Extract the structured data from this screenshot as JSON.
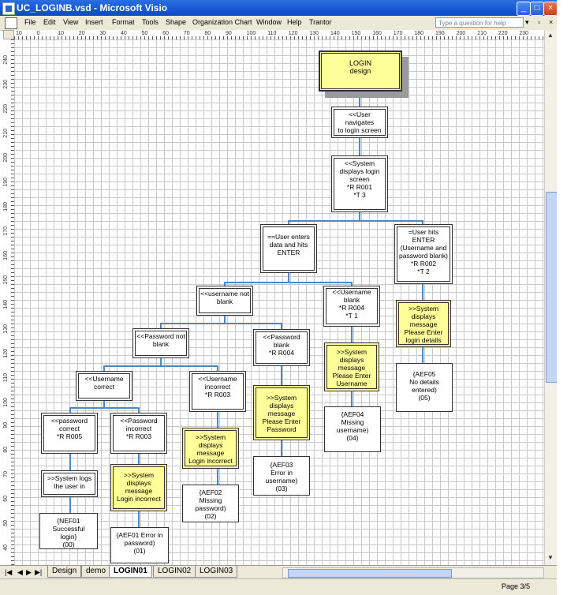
{
  "window": {
    "title": "UC_LOGINB.vsd - Microsoft Visio",
    "minimize_glyph": "_",
    "maximize_glyph": "□",
    "close_glyph": "×"
  },
  "menu": {
    "items": [
      "File",
      "Edit",
      "View",
      "Insert",
      "Format",
      "Tools",
      "Shape",
      "Organization Chart",
      "Window",
      "Help",
      "Trantor"
    ],
    "help_placeholder": "Type a question for help",
    "help_dropdown": "▾",
    "restore_glyph": "▫",
    "close_glyph": "×"
  },
  "ruler": {
    "h_ticks": [
      "10",
      "0",
      "10",
      "20",
      "30",
      "40",
      "50",
      "60",
      "70",
      "80",
      "90",
      "100",
      "110",
      "120",
      "130",
      "140",
      "150",
      "160",
      "170",
      "180",
      "190",
      "200",
      "210",
      "220",
      "230"
    ],
    "v_ticks": [
      "240",
      "230",
      "220",
      "210",
      "200",
      "190",
      "180",
      "170",
      "160",
      "150",
      "140",
      "130",
      "120",
      "110",
      "100",
      "90",
      "80",
      "70",
      "60",
      "50",
      "40"
    ]
  },
  "diagram": {
    "shapes": {
      "login_design": [
        "LOGIN",
        "design"
      ],
      "user_navigates": [
        "<<User navigates",
        "to login screen"
      ],
      "system_displays": [
        "<<System",
        "displays login",
        "screen",
        "*R R001",
        "*T 3"
      ],
      "user_enters": [
        "==User enters",
        "data and hits",
        "ENTER"
      ],
      "user_hits_enter": [
        "=User hits",
        "ENTER",
        "(Username and",
        "password blank)",
        "*R R002",
        "*T 2"
      ],
      "username_not_blank": [
        "<<username not",
        "blank"
      ],
      "username_blank": [
        "<<Username",
        "blank",
        "*R R004",
        "*T 1"
      ],
      "sys_msg_login_details": [
        ">>System",
        "displays message",
        "Please Enter",
        "login details"
      ],
      "password_not_blank": [
        "<<Password not",
        "blank"
      ],
      "password_blank": [
        "<<Password",
        "blank",
        "*R R004"
      ],
      "sys_msg_enter_username": [
        ">>System",
        "displays message",
        "Please Enter",
        "Username"
      ],
      "aef05": [
        "{AEF05",
        "No details",
        "entered)",
        "(05)"
      ],
      "username_correct": [
        "<<Username",
        "correct"
      ],
      "username_incorrect": [
        "<<Username",
        "incorrect",
        "*R R003"
      ],
      "sys_msg_enter_password": [
        ">>System",
        "displays message",
        "Please Enter",
        "Password"
      ],
      "aef04": [
        "{AEF04",
        "Missing",
        "username)",
        "(04)"
      ],
      "password_correct": [
        "<<password",
        "correct",
        "*R R005"
      ],
      "password_incorrect": [
        "<<Password",
        "incorrect",
        "*R R003"
      ],
      "sys_login_incorrect_2": [
        ">>System",
        "displays message",
        "Login incorrect"
      ],
      "aef03": [
        "{AEF03",
        "Error in username)",
        "(03)"
      ],
      "sys_logs_user": [
        ">>System logs",
        "the user in"
      ],
      "sys_login_incorrect_1": [
        ">>System",
        "displays message",
        "Login incorrect"
      ],
      "aef02": [
        "{AEF02",
        "Missing password)",
        "(02)"
      ],
      "nef01": [
        "{NEF01",
        "Successful login}",
        "(00)"
      ],
      "aef01": [
        "{AEF01 Error in",
        "password)",
        "(01)"
      ]
    }
  },
  "tabs": {
    "nav": [
      "|◀",
      "◀",
      "▶",
      "▶|"
    ],
    "pages": [
      "Design",
      "demo",
      "LOGIN01",
      "LOGIN02",
      "LOGIN03"
    ],
    "active": "LOGIN01"
  },
  "status": {
    "page": "Page 3/5"
  },
  "colors": {
    "title_bar": "#0a48c8",
    "highlight_fill": "#ffff99",
    "connector": "#4a86c8",
    "grid": "#c8c8c8"
  }
}
